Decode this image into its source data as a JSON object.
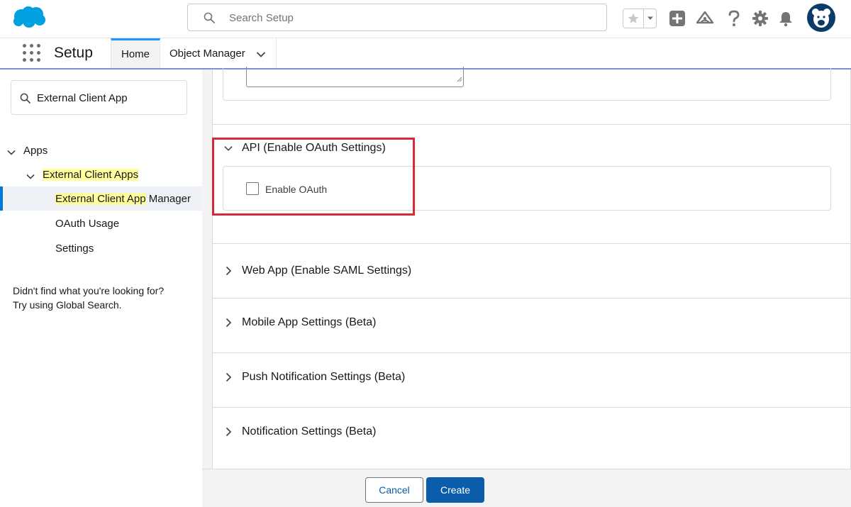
{
  "header": {
    "search_placeholder": "Search Setup",
    "icons": [
      "salesforce-logo",
      "search-icon",
      "star-icon",
      "chevron-down-icon",
      "add-icon",
      "trailhead-icon",
      "help-icon",
      "gear-icon",
      "bell-icon",
      "avatar"
    ]
  },
  "context_bar": {
    "app_name": "Setup",
    "tabs": [
      {
        "label": "Home",
        "active": true
      },
      {
        "label": "Object Manager",
        "active": false
      }
    ]
  },
  "sidebar": {
    "quickfind_value": "External Client App",
    "tree": [
      {
        "label": "Apps",
        "expanded": true
      },
      {
        "label_highlight": "External Client Apps",
        "expanded": true
      },
      {
        "label_highlight": "External Client App",
        "label_rest": " Manager",
        "selected": true
      },
      {
        "label": "OAuth Usage"
      },
      {
        "label": "Settings"
      }
    ],
    "help_line1": "Didn't find what you're looking for?",
    "help_line2": "Try using Global Search."
  },
  "main": {
    "sections": [
      {
        "title": "API (Enable OAuth Settings)",
        "expanded": true,
        "checkbox_label": "Enable OAuth",
        "checked": false
      },
      {
        "title": "Web App (Enable SAML Settings)",
        "expanded": false
      },
      {
        "title": "Mobile App Settings (Beta)",
        "expanded": false
      },
      {
        "title": "Push Notification Settings (Beta)",
        "expanded": false
      },
      {
        "title": "Notification Settings (Beta)",
        "expanded": false
      }
    ]
  },
  "footer": {
    "cancel_label": "Cancel",
    "create_label": "Create"
  },
  "colors": {
    "brand_blue": "#0b5cab",
    "salesforce_cloud": "#00a1e0",
    "highlight_yellow": "#ffff9e",
    "annotation_red": "#d52b38",
    "context_bar_underline": "#7f8de1"
  }
}
